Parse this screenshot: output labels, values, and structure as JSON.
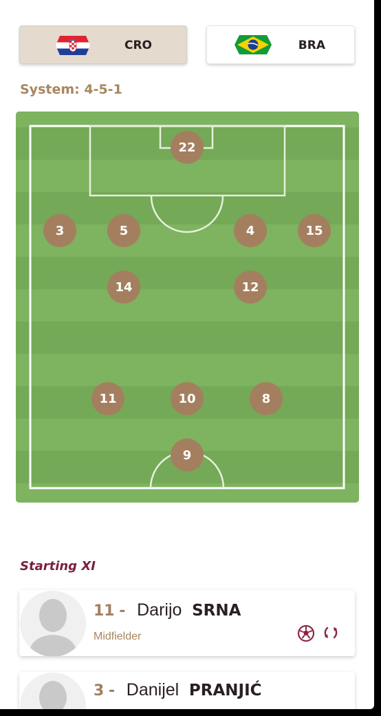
{
  "teams": [
    {
      "code": "CRO",
      "flag": "croatia-flag",
      "selected": true
    },
    {
      "code": "BRA",
      "flag": "brazil-flag",
      "selected": false
    }
  ],
  "system_label": "System: 4-5-1",
  "pitch": {
    "formation": "4-5-1",
    "players": [
      "22",
      "3",
      "5",
      "4",
      "15",
      "14",
      "12",
      "11",
      "10",
      "8",
      "9"
    ]
  },
  "starting_xi": {
    "title": "Starting XI",
    "players": [
      {
        "number": "11",
        "dash": "-",
        "first_name": "Darijo",
        "last_name": "SRNA",
        "position": "Midfielder",
        "icons": [
          "ball-icon",
          "substitution-icon"
        ]
      },
      {
        "number": "3",
        "dash": "-",
        "first_name": "Danijel",
        "last_name": "PRANJIĆ",
        "position": "",
        "icons": []
      }
    ]
  },
  "colors": {
    "accent": "#a47f5f",
    "title_maroon": "#7a1f3a",
    "pitch_light": "#7eb360",
    "pitch_dark": "#74a957",
    "selected_team_bg": "#e4dace"
  }
}
